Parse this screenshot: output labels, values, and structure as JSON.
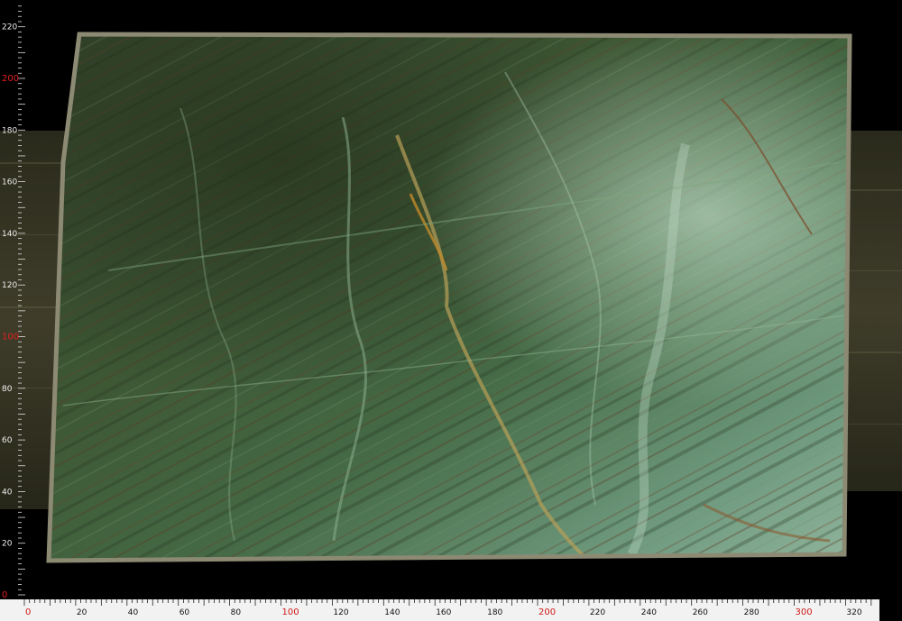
{
  "image": {
    "subject": "polished green quartzite stone slab",
    "colors": {
      "background": "#000000",
      "slab_dark": "#2c3a22",
      "slab_mid": "#4d6b3d",
      "slab_light": "#a9c8b0",
      "vein_rust": "#7a4a2a",
      "vein_gold": "#c08a2a",
      "frame_edge": "#8d8a74",
      "side_band": "#3b3a28",
      "ruler_bg": "#f2f2f2",
      "ruler_major": "#d01818"
    }
  },
  "ruler": {
    "horizontal": {
      "labels": [
        "0",
        "20",
        "40",
        "60",
        "80",
        "100",
        "120",
        "140",
        "160",
        "180",
        "200",
        "220",
        "240",
        "260",
        "280",
        "300",
        "320"
      ],
      "major_labels": [
        "0",
        "100",
        "200",
        "300"
      ],
      "max": 330
    },
    "vertical": {
      "labels": [
        "0",
        "20",
        "40",
        "60",
        "80",
        "100",
        "120",
        "140",
        "160",
        "180",
        "200",
        "220"
      ],
      "major_labels": [
        "0",
        "100",
        "200"
      ],
      "max": 228
    }
  }
}
